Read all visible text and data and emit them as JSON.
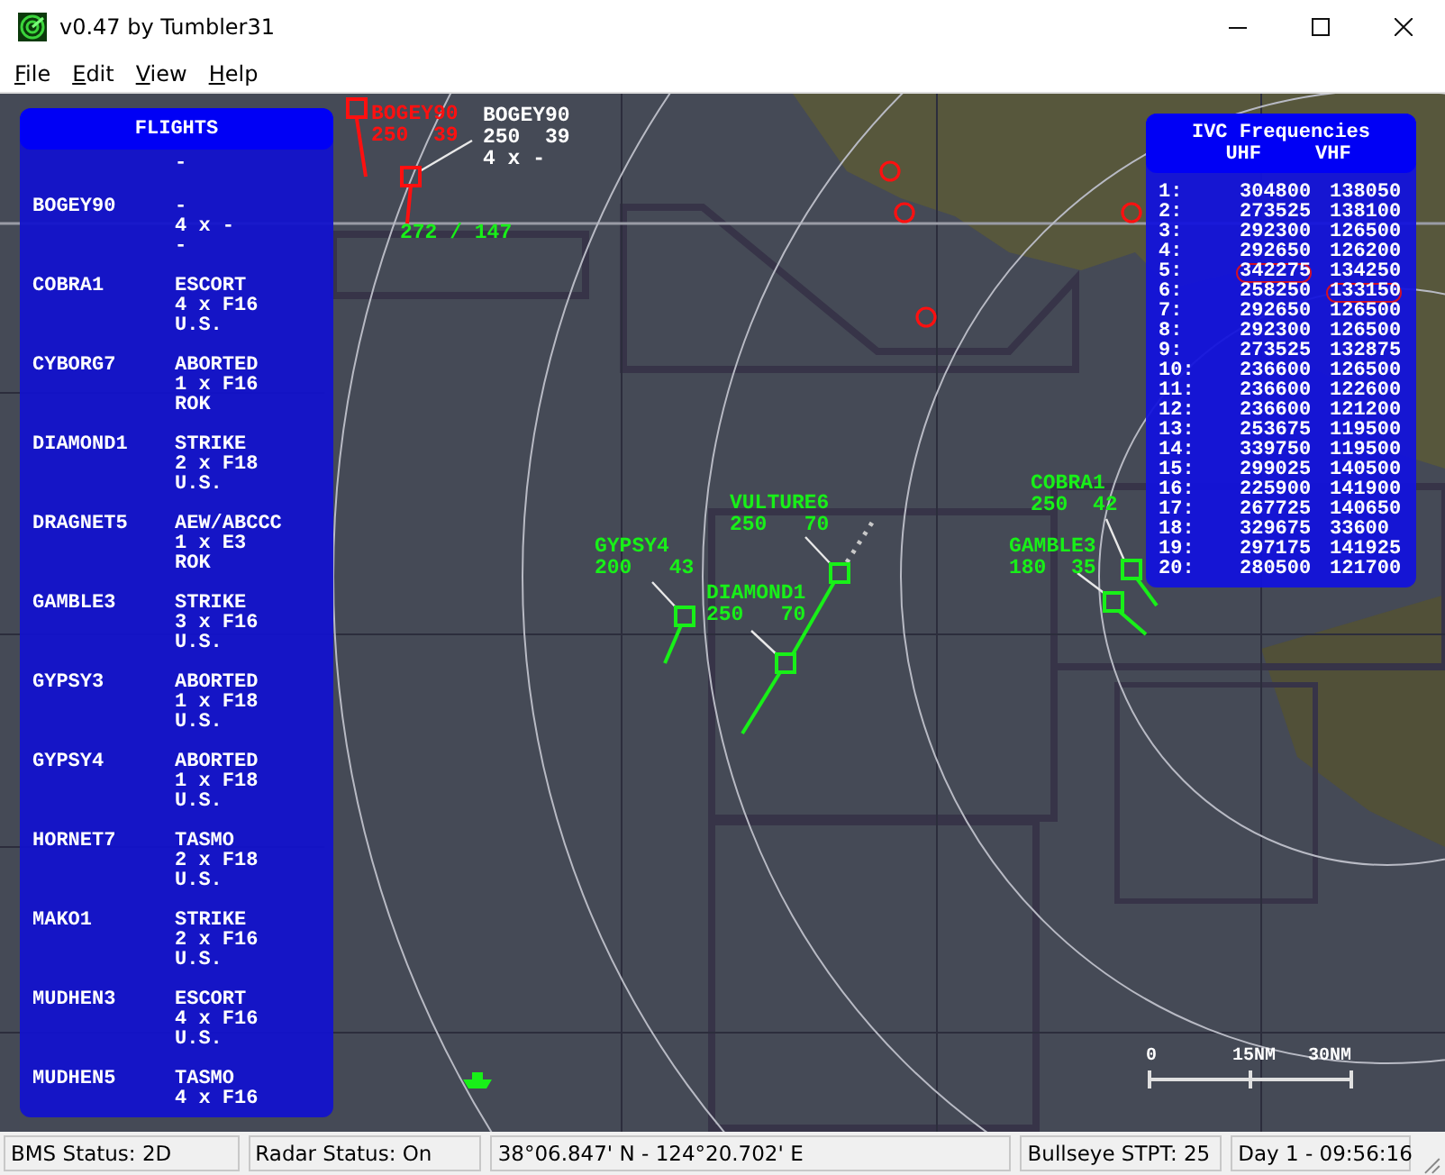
{
  "window": {
    "title": "v0.47 by Tumbler31"
  },
  "menu": [
    "File",
    "Edit",
    "View",
    "Help"
  ],
  "map": {
    "contacts": [
      {
        "kind": "hostile",
        "selected": false,
        "label": [
          "BOGEY90",
          "250  39"
        ]
      },
      {
        "kind": "hostile",
        "selected": true,
        "label": [
          "BOGEY90",
          "250  39",
          "4 x -"
        ],
        "bearing_range": "272 / 147"
      },
      {
        "kind": "friendly",
        "selected": false,
        "label": [
          "VULTURE6",
          "250   70"
        ]
      },
      {
        "kind": "friendly",
        "selected": false,
        "label": [
          "GYPSY4",
          "200   43"
        ]
      },
      {
        "kind": "friendly",
        "selected": false,
        "label": [
          "DIAMOND1",
          "250   70"
        ]
      },
      {
        "kind": "friendly",
        "selected": false,
        "label": [
          "COBRA1",
          "250  42"
        ]
      },
      {
        "kind": "friendly",
        "selected": false,
        "label": [
          "GAMBLE3",
          "180  35"
        ]
      }
    ],
    "scale_bar": [
      "0",
      "15NM",
      "30NM"
    ]
  },
  "flights_panel": {
    "title": "FLIGHTS",
    "clipped_line": "-",
    "flights": [
      {
        "callsign": "BOGEY90",
        "mission": "-",
        "aircraft": "4 x -",
        "country": "-"
      },
      {
        "callsign": "COBRA1",
        "mission": "ESCORT",
        "aircraft": "4 x F16",
        "country": "U.S."
      },
      {
        "callsign": "CYBORG7",
        "mission": "ABORTED",
        "aircraft": "1 x F16",
        "country": "ROK"
      },
      {
        "callsign": "DIAMOND1",
        "mission": "STRIKE",
        "aircraft": "2 x F18",
        "country": "U.S."
      },
      {
        "callsign": "DRAGNET5",
        "mission": "AEW/ABCCC",
        "aircraft": "1 x E3",
        "country": "ROK"
      },
      {
        "callsign": "GAMBLE3",
        "mission": "STRIKE",
        "aircraft": "3 x F16",
        "country": "U.S."
      },
      {
        "callsign": "GYPSY3",
        "mission": "ABORTED",
        "aircraft": "1 x F18",
        "country": "U.S."
      },
      {
        "callsign": "GYPSY4",
        "mission": "ABORTED",
        "aircraft": "1 x F18",
        "country": "U.S."
      },
      {
        "callsign": "HORNET7",
        "mission": "TASMO",
        "aircraft": "2 x F18",
        "country": "U.S."
      },
      {
        "callsign": "MAKO1",
        "mission": "STRIKE",
        "aircraft": "2 x F16",
        "country": "U.S."
      },
      {
        "callsign": "MUDHEN3",
        "mission": "ESCORT",
        "aircraft": "4 x F16",
        "country": "U.S."
      },
      {
        "callsign": "MUDHEN5",
        "mission": "TASMO",
        "aircraft": "4 x F16"
      }
    ]
  },
  "ivc_panel": {
    "title": "IVC Frequencies",
    "columns": [
      "UHF",
      "VHF"
    ],
    "rows": [
      {
        "channel": "1:",
        "uhf": "304800",
        "vhf": "138050",
        "uhf_circled": false,
        "vhf_circled": false
      },
      {
        "channel": "2:",
        "uhf": "273525",
        "vhf": "138100",
        "uhf_circled": false,
        "vhf_circled": false
      },
      {
        "channel": "3:",
        "uhf": "292300",
        "vhf": "126500",
        "uhf_circled": false,
        "vhf_circled": false
      },
      {
        "channel": "4:",
        "uhf": "292650",
        "vhf": "126200",
        "uhf_circled": false,
        "vhf_circled": false
      },
      {
        "channel": "5:",
        "uhf": "342275",
        "vhf": "134250",
        "uhf_circled": true,
        "vhf_circled": false
      },
      {
        "channel": "6:",
        "uhf": "258250",
        "vhf": "133150",
        "uhf_circled": false,
        "vhf_circled": true
      },
      {
        "channel": "7:",
        "uhf": "292650",
        "vhf": "126500",
        "uhf_circled": false,
        "vhf_circled": false
      },
      {
        "channel": "8:",
        "uhf": "292300",
        "vhf": "126500",
        "uhf_circled": false,
        "vhf_circled": false
      },
      {
        "channel": "9:",
        "uhf": "273525",
        "vhf": "132875",
        "uhf_circled": false,
        "vhf_circled": false
      },
      {
        "channel": "10:",
        "uhf": "236600",
        "vhf": "126500",
        "uhf_circled": false,
        "vhf_circled": false
      },
      {
        "channel": "11:",
        "uhf": "236600",
        "vhf": "122600",
        "uhf_circled": false,
        "vhf_circled": false
      },
      {
        "channel": "12:",
        "uhf": "236600",
        "vhf": "121200",
        "uhf_circled": false,
        "vhf_circled": false
      },
      {
        "channel": "13:",
        "uhf": "253675",
        "vhf": "119500",
        "uhf_circled": false,
        "vhf_circled": false
      },
      {
        "channel": "14:",
        "uhf": "339750",
        "vhf": "119500",
        "uhf_circled": false,
        "vhf_circled": false
      },
      {
        "channel": "15:",
        "uhf": "299025",
        "vhf": "140500",
        "uhf_circled": false,
        "vhf_circled": false
      },
      {
        "channel": "16:",
        "uhf": "225900",
        "vhf": "141900",
        "uhf_circled": false,
        "vhf_circled": false
      },
      {
        "channel": "17:",
        "uhf": "267725",
        "vhf": "140650",
        "uhf_circled": false,
        "vhf_circled": false
      },
      {
        "channel": "18:",
        "uhf": "329675",
        "vhf": "33600",
        "uhf_circled": false,
        "vhf_circled": false
      },
      {
        "channel": "19:",
        "uhf": "297175",
        "vhf": "141925",
        "uhf_circled": false,
        "vhf_circled": false
      },
      {
        "channel": "20:",
        "uhf": "280500",
        "vhf": "121700",
        "uhf_circled": false,
        "vhf_circled": false
      }
    ]
  },
  "status_bar": [
    "BMS Status: 2D",
    "Radar Status: On",
    "38°06.847' N - 124°20.702' E",
    "Bullseye STPT: 25",
    "Day 1 - 09:56:16"
  ]
}
